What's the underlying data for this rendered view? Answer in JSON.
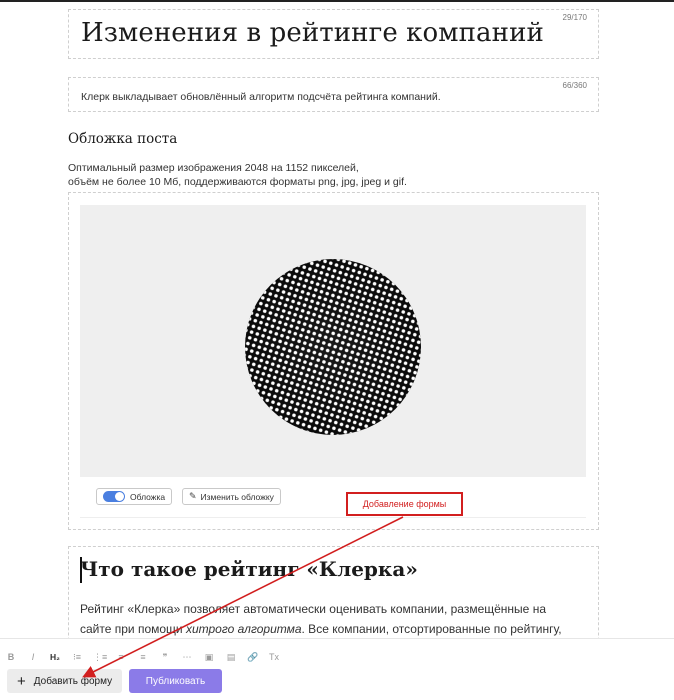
{
  "title": {
    "text": "Изменения в рейтинге компаний",
    "counter": "29/170"
  },
  "lead": {
    "text": "Клерк выкладывает обновлённый алгоритм подсчёта рейтинга компаний.",
    "counter": "66/360"
  },
  "cover": {
    "section_title": "Обложка поста",
    "hint_line1": "Оптимальный размер изображения 2048 на 1152 пикселей,",
    "hint_line2": "объём не более 10 Мб, поддерживаются форматы png, jpg, jpeg и gif.",
    "toggle_label": "Обложка",
    "change_label": "Изменить обложку"
  },
  "annotation": {
    "text": "Добавление формы",
    "color": "#d21f1f"
  },
  "article": {
    "heading": "Что такое рейтинг «Клерка»",
    "p_part1": "Рейтинг «Клерка» позволяет автоматически оценивать компании, размещённые на сайте при помощи ",
    "p_italic": "хитрого алгоритма",
    "p_part2": ". Все компании, отсортированные по рейтингу,"
  },
  "toolbar": {
    "items": [
      {
        "label": "B",
        "icon": "bold-icon"
      },
      {
        "label": "I",
        "icon": "italic-icon"
      },
      {
        "label": "H₂",
        "icon": "heading-2-icon"
      },
      {
        "label": "⁝≡",
        "icon": "numbered-list-icon"
      },
      {
        "label": "⋮≡",
        "icon": "bulleted-list-icon"
      },
      {
        "label": "≡",
        "icon": "align-left-icon"
      },
      {
        "label": "≡",
        "icon": "align-center-icon"
      },
      {
        "label": "❞",
        "icon": "quote-icon"
      },
      {
        "label": "⋯",
        "icon": "video-icon"
      },
      {
        "label": "▣",
        "icon": "image-icon"
      },
      {
        "label": "▤",
        "icon": "table-icon"
      },
      {
        "label": "🔗",
        "icon": "link-icon"
      },
      {
        "label": "Tx",
        "icon": "clear-format-icon"
      }
    ],
    "add_form": "Добавить форму",
    "publish": "Публиковать",
    "publish_color": "#8b7be8"
  }
}
